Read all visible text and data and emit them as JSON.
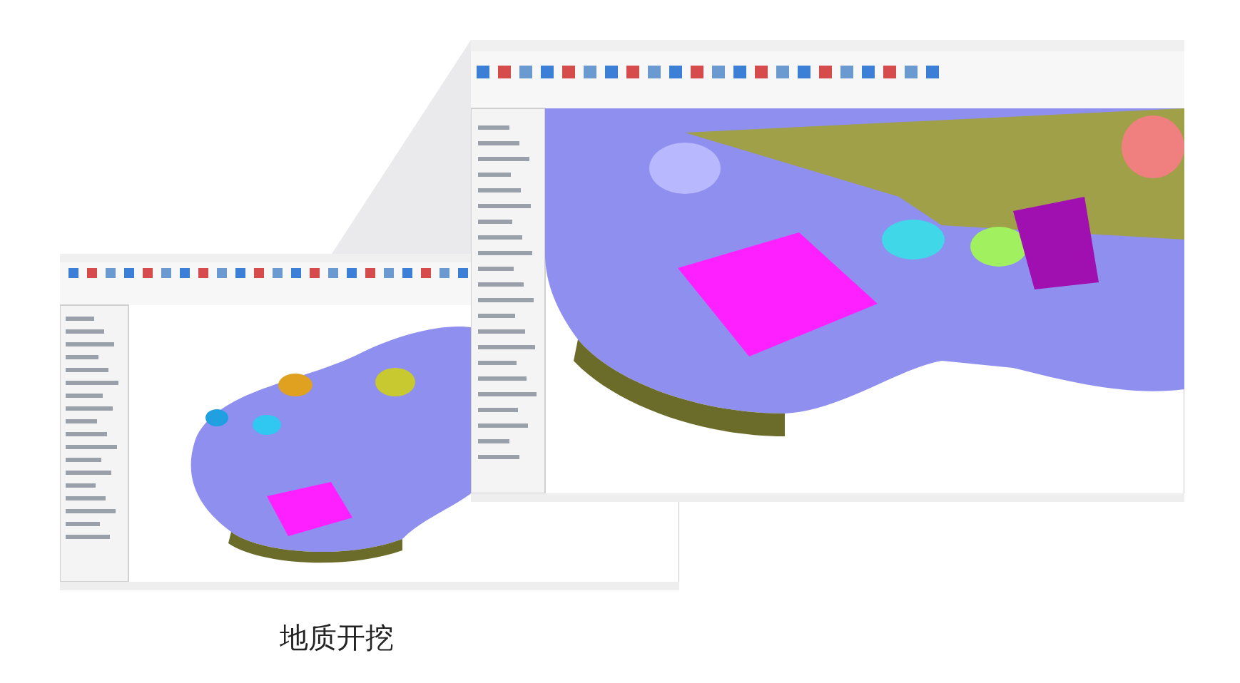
{
  "caption": "地质开挖"
}
